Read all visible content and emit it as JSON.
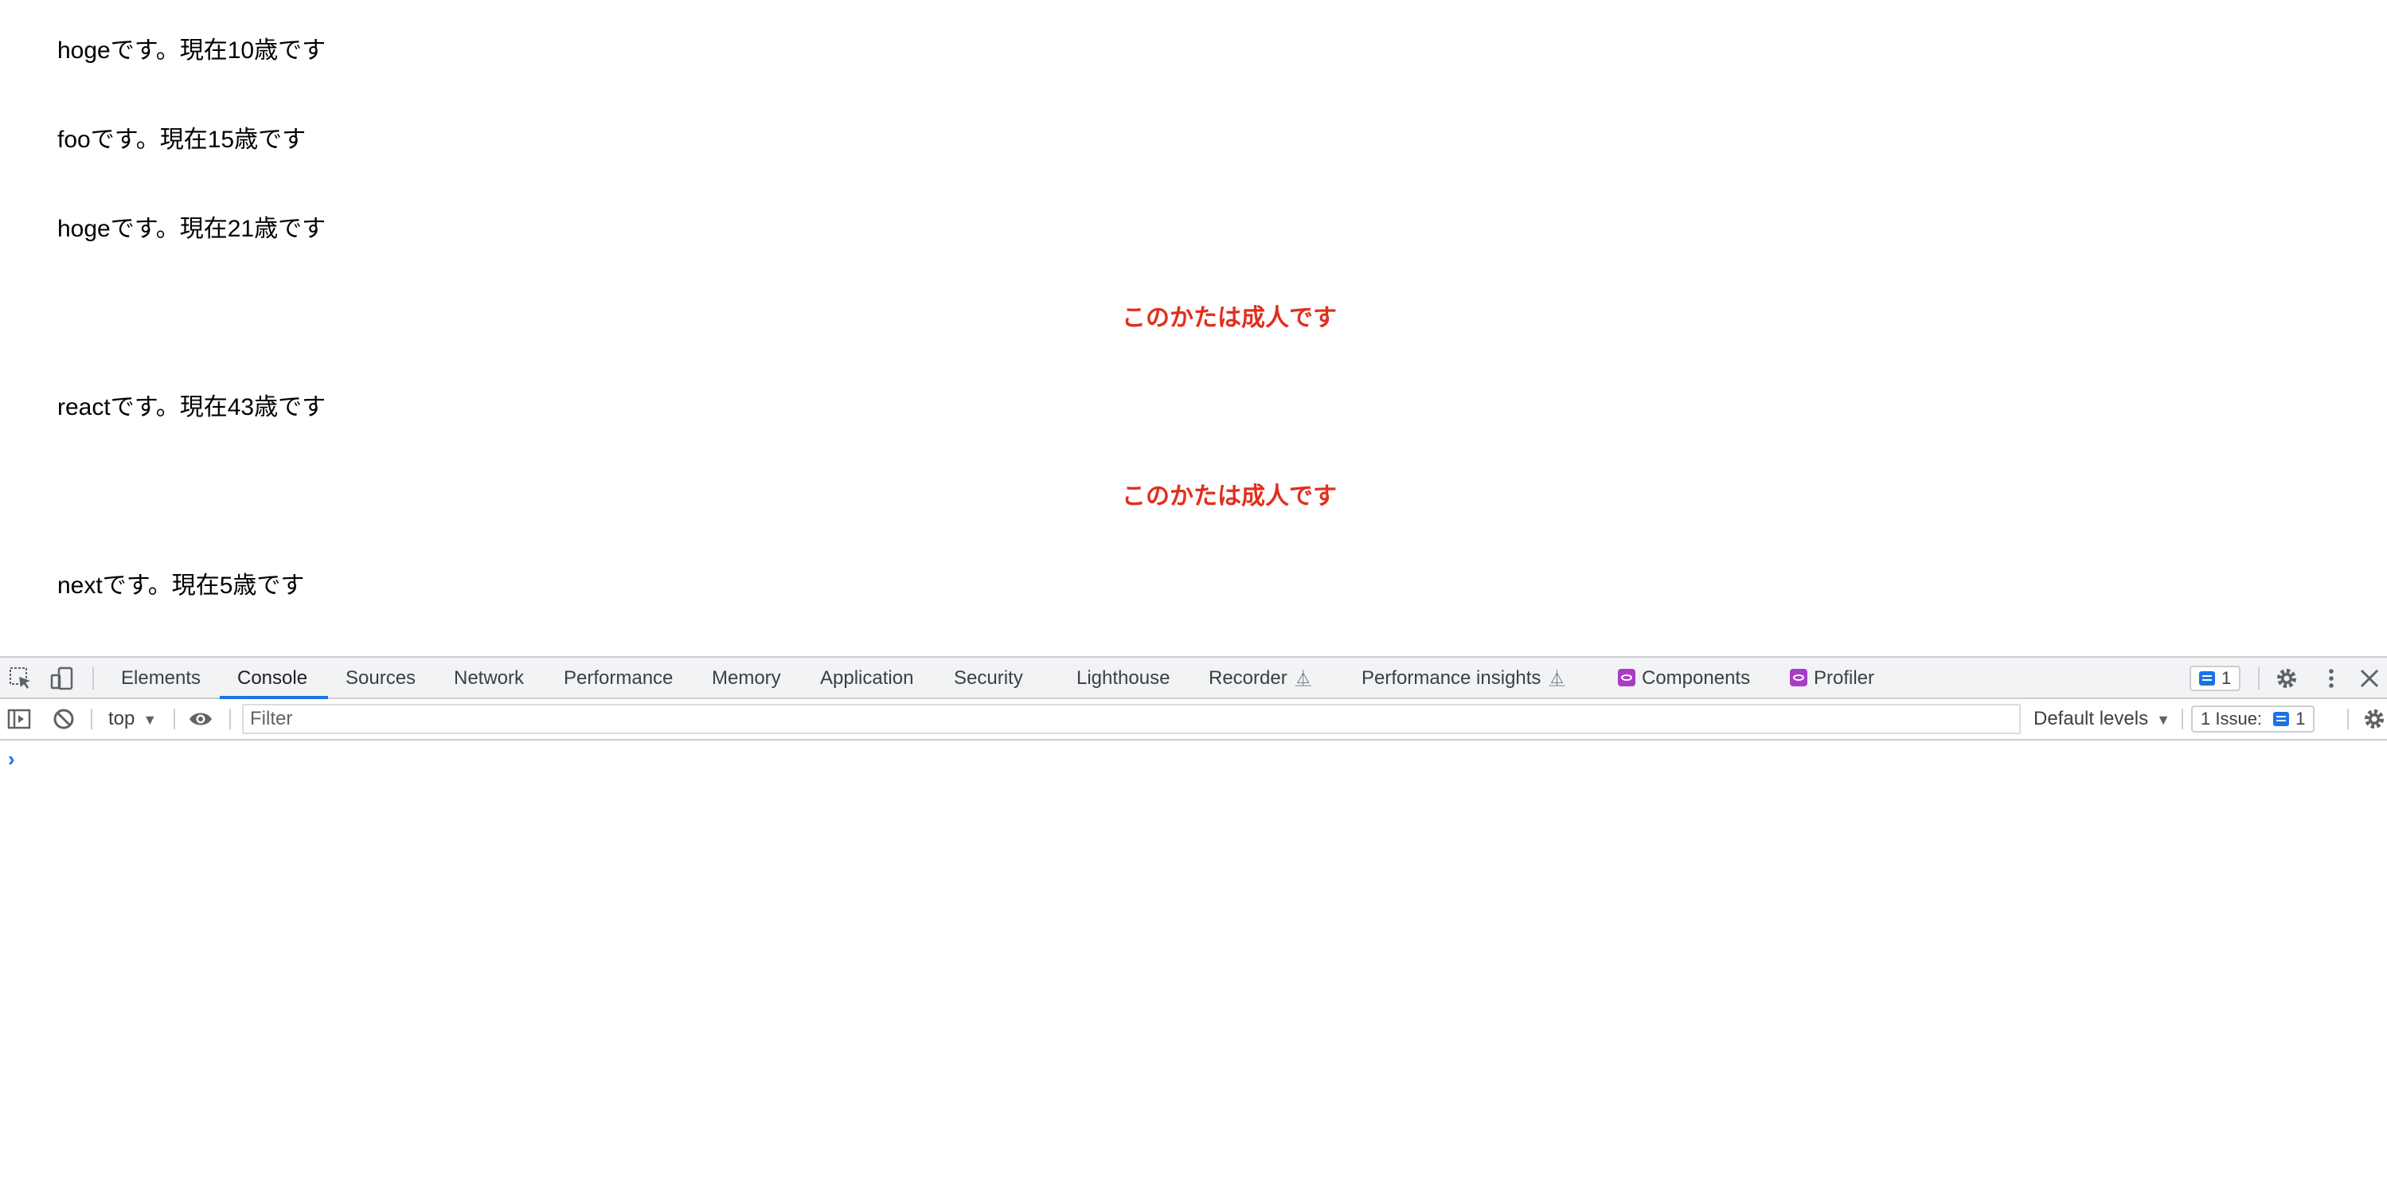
{
  "page": {
    "people": [
      {
        "text": "hogeです。現在10歳です",
        "adult": false
      },
      {
        "text": "fooです。現在15歳です",
        "adult": false
      },
      {
        "text": "hogeです。現在21歳です",
        "adult": true
      },
      {
        "text": "reactです。現在43歳です",
        "adult": true
      },
      {
        "text": "nextです。現在5歳です",
        "adult": false
      }
    ],
    "adult_label": "このかたは成人です",
    "adult_color": "#e0301e"
  },
  "devtools": {
    "tabs": [
      "Elements",
      "Console",
      "Sources",
      "Network",
      "Performance",
      "Memory",
      "Application",
      "Security",
      "Lighthouse",
      "Recorder",
      "Performance insights",
      "Components",
      "Profiler"
    ],
    "active_tab": "Console",
    "issues_badge_count": "1",
    "toolbar": {
      "context": "top",
      "filter_placeholder": "Filter",
      "levels": "Default levels",
      "issues_label": "1 Issue:",
      "issues_count": "1"
    },
    "prompt": "›",
    "accent_color": "#1a73e8"
  }
}
